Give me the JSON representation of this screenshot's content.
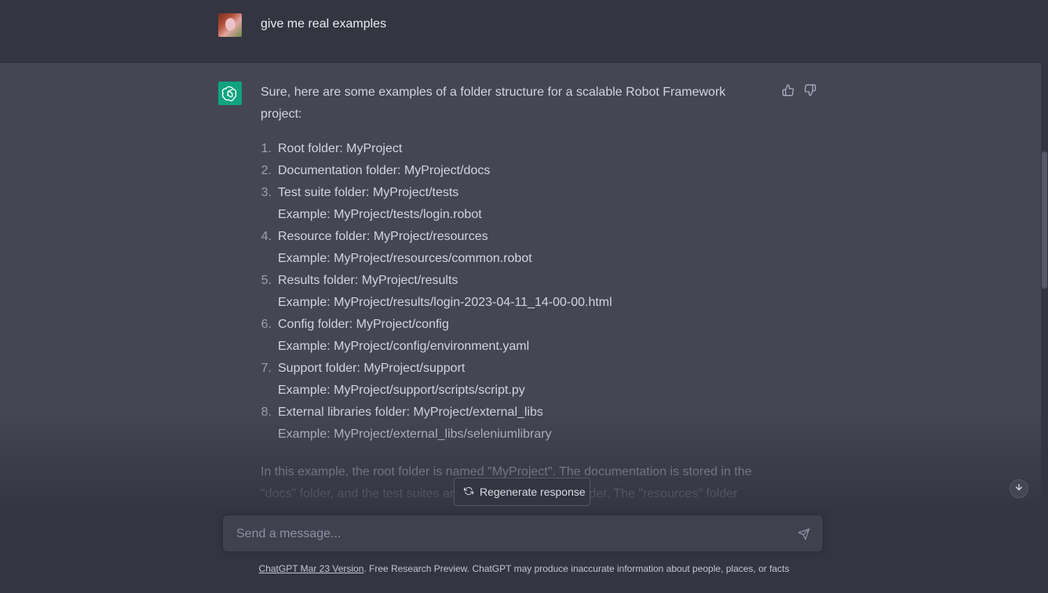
{
  "user_message": {
    "text": "give me real examples"
  },
  "assistant_message": {
    "intro": "Sure, here are some examples of a folder structure for a scalable Robot Framework project:",
    "items": [
      {
        "num": "1.",
        "lines": [
          "Root folder: MyProject"
        ]
      },
      {
        "num": "2.",
        "lines": [
          "Documentation folder: MyProject/docs"
        ]
      },
      {
        "num": "3.",
        "lines": [
          "Test suite folder: MyProject/tests",
          "Example: MyProject/tests/login.robot"
        ]
      },
      {
        "num": "4.",
        "lines": [
          "Resource folder: MyProject/resources",
          "Example: MyProject/resources/common.robot"
        ]
      },
      {
        "num": "5.",
        "lines": [
          "Results folder: MyProject/results",
          "Example: MyProject/results/login-2023-04-11_14-00-00.html"
        ]
      },
      {
        "num": "6.",
        "lines": [
          "Config folder: MyProject/config",
          "Example: MyProject/config/environment.yaml"
        ]
      },
      {
        "num": "7.",
        "lines": [
          "Support folder: MyProject/support",
          "Example: MyProject/support/scripts/script.py"
        ]
      },
      {
        "num": "8.",
        "lines": [
          "External libraries folder: MyProject/external_libs",
          "Example: MyProject/external_libs/seleniumlibrary"
        ]
      }
    ],
    "summary": "In this example, the root folder is named \"MyProject\". The documentation is stored in the \"docs\" folder, and the test suites are stored in the \"tests\" folder. The \"resources\" folder contains reusable resources such as keywords and variables. The \"results\" folder"
  },
  "regenerate": {
    "label": "Regenerate response"
  },
  "composer": {
    "placeholder": "Send a message..."
  },
  "footer": {
    "version_link": "ChatGPT Mar 23 Version",
    "disclaimer": ". Free Research Preview. ChatGPT may produce inaccurate information about people, places, or facts"
  },
  "colors": {
    "accent": "#10a37f",
    "background_assistant": "#444654",
    "background_user": "#343541"
  },
  "icons": [
    "openai-logo-icon",
    "thumbs-up-icon",
    "thumbs-down-icon",
    "regenerate-icon",
    "send-icon",
    "arrow-down-icon"
  ]
}
